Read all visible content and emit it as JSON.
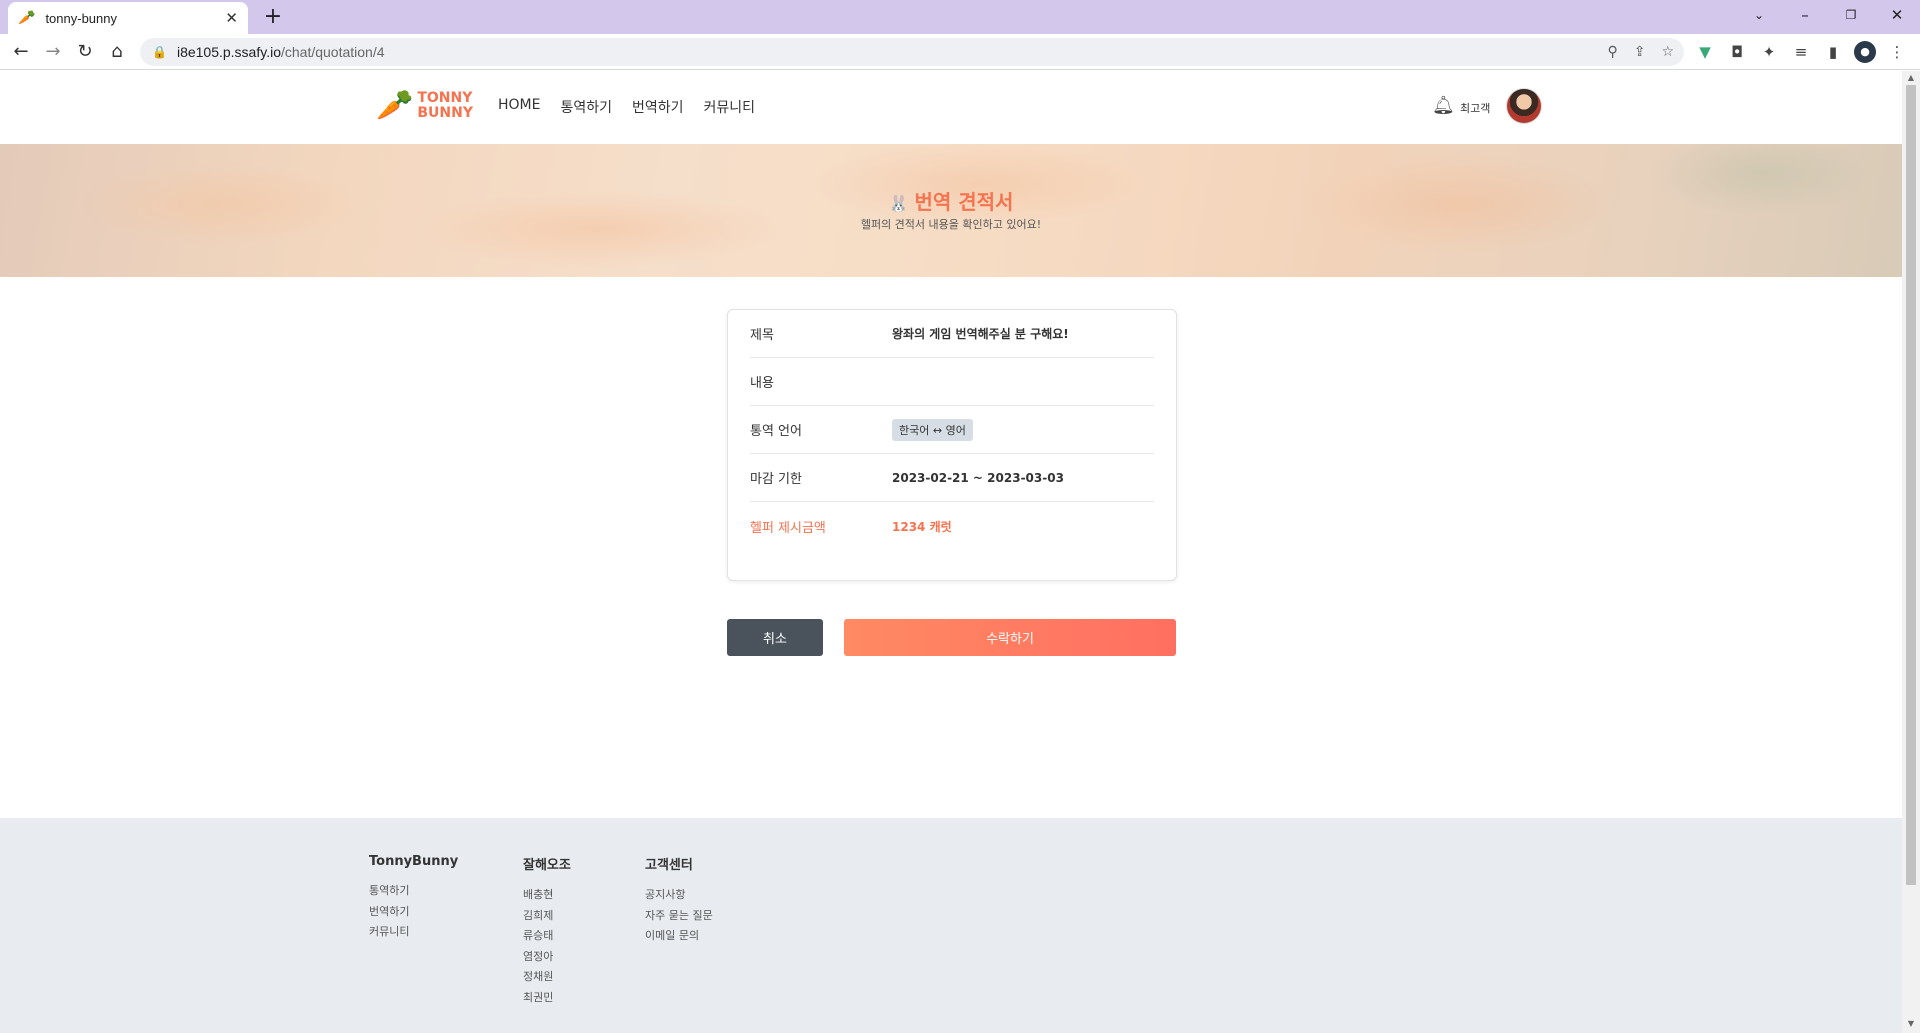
{
  "browser": {
    "tab_title": "tonny-bunny",
    "url_host": "i8e105.p.ssafy.io",
    "url_path": "/chat/quotation/4"
  },
  "header": {
    "logo_line1": "TONNY",
    "logo_line2": "BUNNY",
    "nav": [
      "HOME",
      "통역하기",
      "번역하기",
      "커뮤니티"
    ],
    "username": "최고객"
  },
  "hero": {
    "title": "번역 견적서",
    "subtitle": "헬퍼의 견적서 내용을 확인하고 있어요!"
  },
  "quotation": {
    "title_label": "제목",
    "title_value": "왕좌의 게임 번역해주실 분 구해요!",
    "content_label": "내용",
    "content_value": "",
    "language_label": "통역 언어",
    "language_value": "한국어 ↔ 영어",
    "deadline_label": "마감 기한",
    "deadline_value": "2023-02-21 ~ 2023-03-03",
    "price_label": "헬퍼 제시금액",
    "price_value": "1234 캐럿"
  },
  "actions": {
    "cancel_label": "취소",
    "accept_label": "수락하기"
  },
  "footer": {
    "col1_title": "TonnyBunny",
    "col1_items": [
      "통역하기",
      "번역하기",
      "커뮤니티"
    ],
    "col2_title": "잘해오조",
    "col2_items": [
      "배충현",
      "김희제",
      "류승태",
      "염정아",
      "정채원",
      "최권민"
    ],
    "col3_title": "고객센터",
    "col3_items": [
      "공지사항",
      "자주 묻는 질문",
      "이메일 문의"
    ]
  },
  "colors": {
    "accent": "#f5734f",
    "tab_bar": "#d4c7ec",
    "footer_bg": "#e8ecf0",
    "cancel_button": "#4a535c"
  }
}
